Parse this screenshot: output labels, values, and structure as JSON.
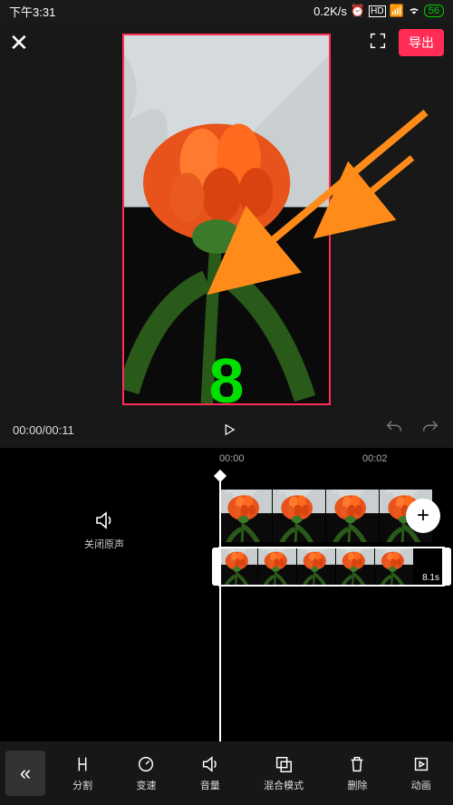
{
  "status": {
    "time": "下午3:31",
    "net": "0.2K/s",
    "battery": "56"
  },
  "top": {
    "export_label": "导出"
  },
  "overlay": {
    "number": "8"
  },
  "playback": {
    "time": "00:00/00:11"
  },
  "ruler": {
    "t0": "00:00",
    "t1": "00:02"
  },
  "audio": {
    "mute_label": "关闭原声"
  },
  "clips": {
    "row2_duration": "8.1s"
  },
  "tools": {
    "split": "分割",
    "speed": "变速",
    "volume": "音量",
    "blend": "混合模式",
    "delete": "删除",
    "anim": "动画"
  }
}
